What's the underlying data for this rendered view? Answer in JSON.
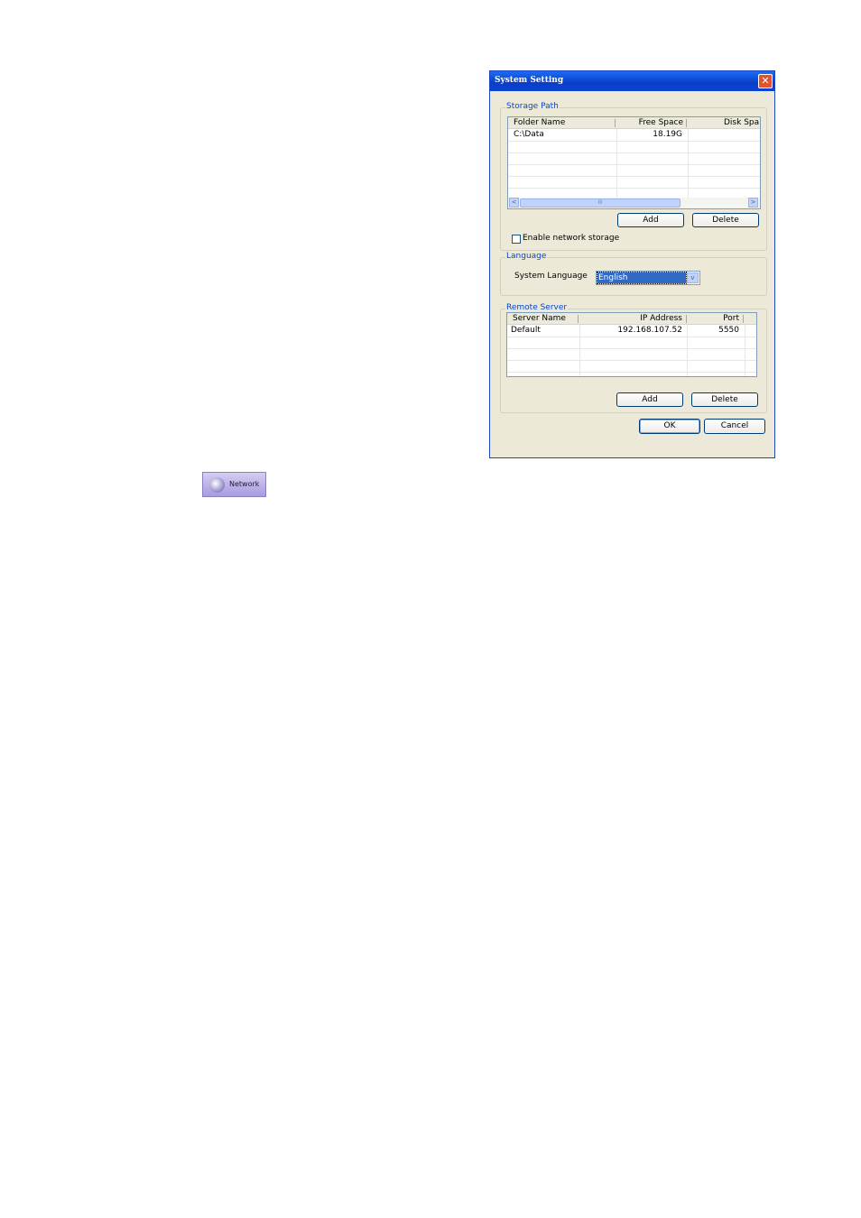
{
  "window": {
    "title": "System Setting",
    "close_symbol": "✕"
  },
  "storage": {
    "group_label": "Storage Path",
    "columns": [
      "Folder Name",
      "Free Space",
      "Disk Spa"
    ],
    "rows": [
      {
        "folder": "C:\\Data",
        "free": "18.19G",
        "disk": ""
      }
    ],
    "add_label": "Add",
    "delete_label": "Delete",
    "enable_network_label": "Enable network storage",
    "enable_network_checked": false,
    "scroll_left": "<",
    "scroll_right": ">",
    "scroll_thumb": "III"
  },
  "language": {
    "group_label": "Language",
    "field_label": "System Language",
    "selected": "English",
    "arrow": "v"
  },
  "remote": {
    "group_label": "Remote Server",
    "columns": [
      "Server Name",
      "IP Address",
      "Port"
    ],
    "rows": [
      {
        "name": "Default",
        "ip": "192.168.107.52",
        "port": "5550"
      }
    ],
    "add_label": "Add",
    "delete_label": "Delete"
  },
  "footer": {
    "ok_label": "OK",
    "cancel_label": "Cancel"
  },
  "network_button": {
    "label": "Network",
    "icon": "network-globe-icon"
  }
}
